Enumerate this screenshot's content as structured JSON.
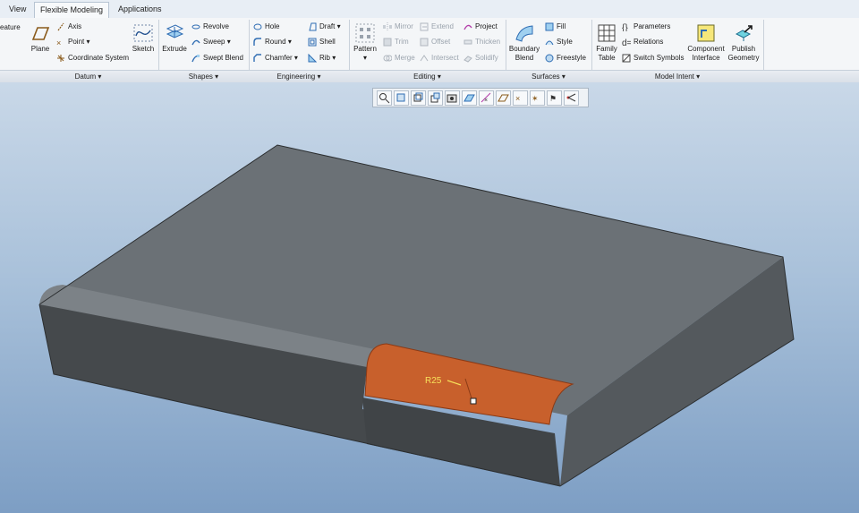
{
  "tabs": [
    {
      "label": "View",
      "active": false
    },
    {
      "label": "Flexible Modeling",
      "active": false
    },
    {
      "label": "Applications",
      "active": false
    }
  ],
  "ribbon": {
    "cut_label": "eature",
    "datum": {
      "group": "Datum",
      "plane": "Plane",
      "axis": "Axis",
      "point": "Point",
      "coordinate_system": "Coordinate System",
      "sketch": "Sketch"
    },
    "shapes": {
      "group": "Shapes",
      "extrude": "Extrude",
      "revolve": "Revolve",
      "sweep": "Sweep",
      "swept_blend": "Swept Blend"
    },
    "engineering": {
      "group": "Engineering",
      "hole": "Hole",
      "round": "Round",
      "chamfer": "Chamfer",
      "draft": "Draft",
      "shell": "Shell",
      "rib": "Rib"
    },
    "editing": {
      "group": "Editing",
      "pattern": "Pattern",
      "mirror": "Mirror",
      "trim": "Trim",
      "merge": "Merge",
      "extend": "Extend",
      "offset": "Offset",
      "intersect": "Intersect",
      "project": "Project",
      "thicken": "Thicken",
      "solidify": "Solidify"
    },
    "surfaces": {
      "group": "Surfaces",
      "boundary_blend_1": "Boundary",
      "boundary_blend_2": "Blend",
      "fill": "Fill",
      "style": "Style",
      "freestyle": "Freestyle"
    },
    "model_intent": {
      "group": "Model Intent",
      "family_table_1": "Family",
      "family_table_2": "Table",
      "parameters": "Parameters",
      "relations": "Relations",
      "switch_symbols": "Switch Symbols",
      "component_interface_1": "Component",
      "component_interface_2": "Interface",
      "publish_geometry_1": "Publish",
      "publish_geometry_2": "Geometry"
    }
  },
  "viewport": {
    "dimension_label": "R25",
    "highlight_color": "#c8602c",
    "part_color": "#5f6468"
  },
  "colors": {
    "accent": "#2f6db3",
    "ribbon_bg": "#f4f6f8"
  }
}
